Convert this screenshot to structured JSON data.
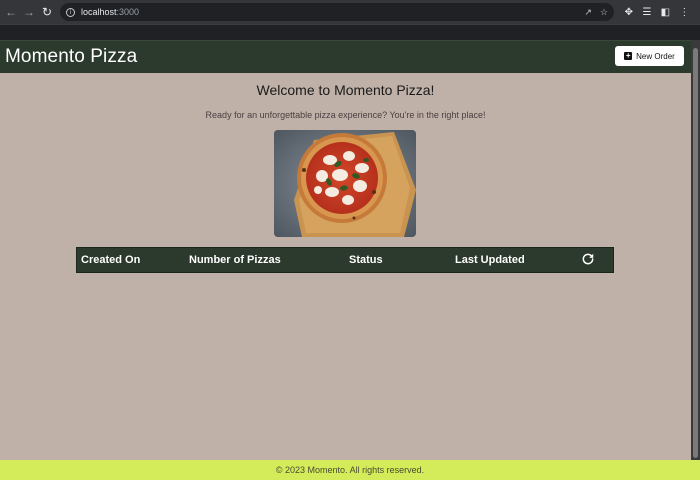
{
  "browser": {
    "url_host": "localhost",
    "url_port": ":3000",
    "icons": [
      "back-icon",
      "forward-icon",
      "reload-icon",
      "site-info-icon",
      "share-icon",
      "bookmark-star-icon",
      "extensions-icon",
      "media-icon",
      "side-panel-icon",
      "menu-icon"
    ]
  },
  "header": {
    "title": "Momento Pizza",
    "new_order_label": "New Order"
  },
  "main": {
    "welcome": "Welcome to Momento Pizza!",
    "subtitle": "Ready for an unforgettable pizza experience? You're in the right place!"
  },
  "table": {
    "columns": [
      "Created On",
      "Number of Pizzas",
      "Status",
      "Last Updated"
    ],
    "rows": []
  },
  "footer": {
    "text": "© 2023 Momento. All rights reserved."
  },
  "colors": {
    "page_bg": "#bfb1a8",
    "header_bg": "#2b3a2d",
    "footer_bg": "#d4ec5a"
  }
}
